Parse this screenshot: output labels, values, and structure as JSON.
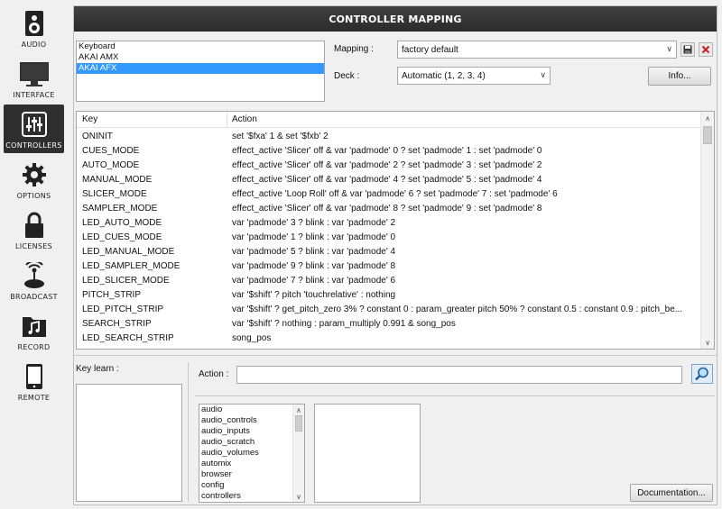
{
  "sidebar": {
    "items": [
      {
        "label": "AUDIO",
        "icon": "speaker-icon"
      },
      {
        "label": "INTERFACE",
        "icon": "monitor-icon"
      },
      {
        "label": "CONTROLLERS",
        "icon": "sliders-icon"
      },
      {
        "label": "OPTIONS",
        "icon": "gear-icon"
      },
      {
        "label": "LICENSES",
        "icon": "lock-icon"
      },
      {
        "label": "BROADCAST",
        "icon": "broadcast-icon"
      },
      {
        "label": "RECORD",
        "icon": "music-folder-icon"
      },
      {
        "label": "REMOTE",
        "icon": "tablet-icon"
      }
    ],
    "active": "CONTROLLERS"
  },
  "header": {
    "title": "CONTROLLER MAPPING"
  },
  "devices": {
    "items": [
      "Keyboard",
      "AKAI AMX",
      "AKAI AFX"
    ],
    "selected": "AKAI AFX"
  },
  "mapping": {
    "label": "Mapping :",
    "value": "factory default",
    "save_icon": "save-icon",
    "delete_icon": "delete-icon"
  },
  "deck": {
    "label": "Deck :",
    "value": "Automatic (1, 2, 3, 4)"
  },
  "info_button": "Info...",
  "table": {
    "headers": {
      "key": "Key",
      "action": "Action"
    },
    "rows": [
      {
        "key": "ONINIT",
        "action": "set '$fxa' 1 & set '$fxb' 2"
      },
      {
        "key": "CUES_MODE",
        "action": "effect_active 'Slicer' off & var 'padmode' 0 ? set 'padmode' 1 : set 'padmode' 0"
      },
      {
        "key": "AUTO_MODE",
        "action": "effect_active 'Slicer' off & var 'padmode' 2 ? set 'padmode' 3 : set 'padmode' 2"
      },
      {
        "key": "MANUAL_MODE",
        "action": "effect_active 'Slicer' off & var 'padmode' 4 ? set 'padmode' 5 : set 'padmode' 4"
      },
      {
        "key": "SLICER_MODE",
        "action": "effect_active 'Loop Roll' off & var 'padmode' 6 ? set 'padmode' 7 : set 'padmode' 6"
      },
      {
        "key": "SAMPLER_MODE",
        "action": "effect_active 'Slicer' off & var 'padmode' 8 ? set 'padmode' 9 : set 'padmode' 8"
      },
      {
        "key": "LED_AUTO_MODE",
        "action": "var 'padmode' 3 ? blink : var 'padmode' 2"
      },
      {
        "key": "LED_CUES_MODE",
        "action": "var 'padmode' 1 ? blink : var 'padmode' 0"
      },
      {
        "key": "LED_MANUAL_MODE",
        "action": "var 'padmode' 5 ? blink : var 'padmode' 4"
      },
      {
        "key": "LED_SAMPLER_MODE",
        "action": "var 'padmode' 9 ? blink : var 'padmode' 8"
      },
      {
        "key": "LED_SLICER_MODE",
        "action": "var 'padmode' 7 ? blink : var 'padmode' 6"
      },
      {
        "key": "PITCH_STRIP",
        "action": "var '$shift' ? pitch 'touchrelative' : nothing"
      },
      {
        "key": "LED_PITCH_STRIP",
        "action": "var '$shift' ? get_pitch_zero 3% ? constant 0 : param_greater pitch 50% ? constant 0.5 : constant 0.9 : pitch_be..."
      },
      {
        "key": "SEARCH_STRIP",
        "action": "var '$shift' ? nothing : param_multiply 0.991 & song_pos"
      },
      {
        "key": "LED_SEARCH_STRIP",
        "action": "song_pos"
      }
    ]
  },
  "key_learn": {
    "label": "Key learn :"
  },
  "action_field": {
    "label": "Action :",
    "value": "",
    "search_icon": "magnifier-icon"
  },
  "verbs": {
    "items": [
      "audio",
      "audio_controls",
      "audio_inputs",
      "audio_scratch",
      "audio_volumes",
      "automix",
      "browser",
      "config",
      "controllers"
    ]
  },
  "documentation_button": "Documentation..."
}
